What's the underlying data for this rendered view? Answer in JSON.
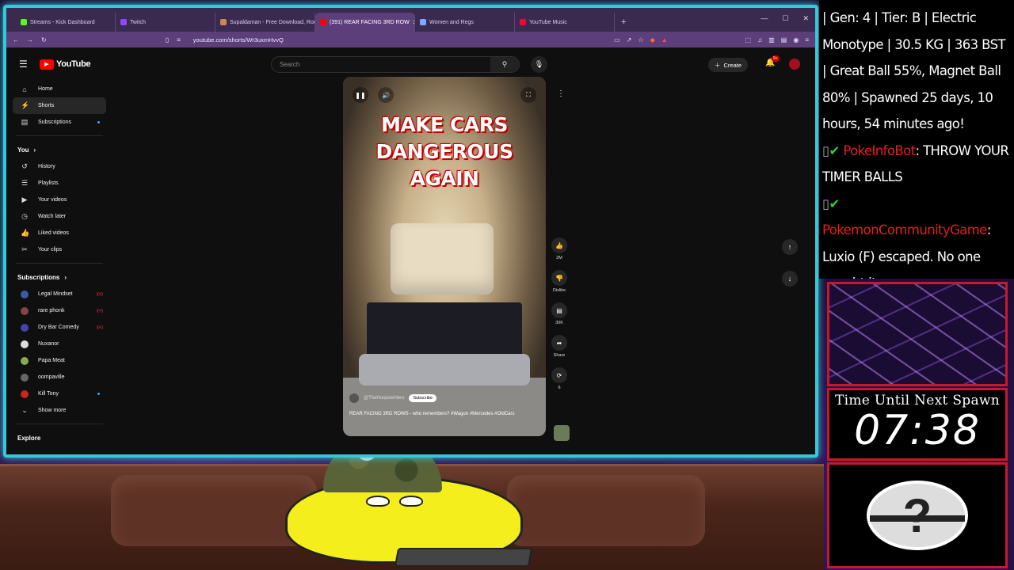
{
  "browser": {
    "tabs": [
      {
        "label": "Streams - Kick Dashboard",
        "color": "#53fc18"
      },
      {
        "label": "Twitch",
        "color": "#9146ff"
      },
      {
        "label": "Supaldaman - Free Download, Rom:",
        "color": "#c98a55"
      },
      {
        "label": "(391) REAR FACING 3RD ROW",
        "color": "#ff0000",
        "active": true
      },
      {
        "label": "Women and Regs",
        "color": "#7fa8ff"
      },
      {
        "label": "YouTube Music",
        "color": "#ff0033"
      }
    ],
    "new_tab": "+",
    "url": "youtube.com/shorts/Wr3uxmHvvQ"
  },
  "youtube": {
    "logo_text": "YouTube",
    "search_placeholder": "Search",
    "create_label": "Create",
    "notif_count": "9+",
    "sidebar_main": [
      {
        "label": "Home",
        "icon": "⌂"
      },
      {
        "label": "Shorts",
        "icon": "⚡",
        "active": true
      },
      {
        "label": "Subscriptions",
        "icon": "▤",
        "dot": true
      }
    ],
    "you_header": "You",
    "sidebar_you": [
      {
        "label": "History",
        "icon": "↺"
      },
      {
        "label": "Playlists",
        "icon": "☰"
      },
      {
        "label": "Your videos",
        "icon": "▶"
      },
      {
        "label": "Watch later",
        "icon": "◷"
      },
      {
        "label": "Liked videos",
        "icon": "👍"
      },
      {
        "label": "Your clips",
        "icon": "✂"
      }
    ],
    "subs_header": "Subscriptions",
    "subscriptions": [
      {
        "label": "Legal Mindset",
        "color": "#3b5aa8",
        "live": true
      },
      {
        "label": "rare phonk",
        "color": "#884444",
        "live": true
      },
      {
        "label": "Dry Bar Comedy",
        "color": "#4444aa",
        "live": true
      },
      {
        "label": "Nuxanor",
        "color": "#dddddd"
      },
      {
        "label": "Papa Meat",
        "color": "#88aa55"
      },
      {
        "label": "oompaville",
        "color": "#666666"
      },
      {
        "label": "Kill Tony",
        "color": "#cc2222",
        "dot": true
      }
    ],
    "show_more": "Show more",
    "explore": "Explore",
    "short": {
      "title_line1": "MAKE CARS",
      "title_line2": "DANGEROUS AGAIN",
      "channel": "@TheHoopsieHero",
      "subscribe": "Subscribe",
      "description": "REAR FACING 3RD ROWS - who remembers? #Wagon #Mercedes #OldCars"
    },
    "actions": [
      {
        "icon": "👍",
        "label": "2M"
      },
      {
        "icon": "👎",
        "label": "Dislike"
      },
      {
        "icon": "▤",
        "label": "30K"
      },
      {
        "icon": "➦",
        "label": "Share"
      },
      {
        "icon": "⟳",
        "label": "6"
      }
    ]
  },
  "chat": [
    {
      "text": "| Gen: 4 | Tier: B | Electric Monotype | 30.5 KG | 363 BST | Great Ball 55%, Magnet Ball 80% | Spawned 25 days, 10 hours, 54 minutes ago!"
    },
    {
      "name": "PokeInfoBot",
      "text": ": THROW YOUR TIMER BALLS"
    },
    {
      "name": "PokemonCommunityGame",
      "text": ": Luxio (F) escaped. No one caught it."
    }
  ],
  "overlay": {
    "timer_label": "Time Until Next Spawn",
    "timer_value": "07:38",
    "pokeball_glyph": "?"
  }
}
